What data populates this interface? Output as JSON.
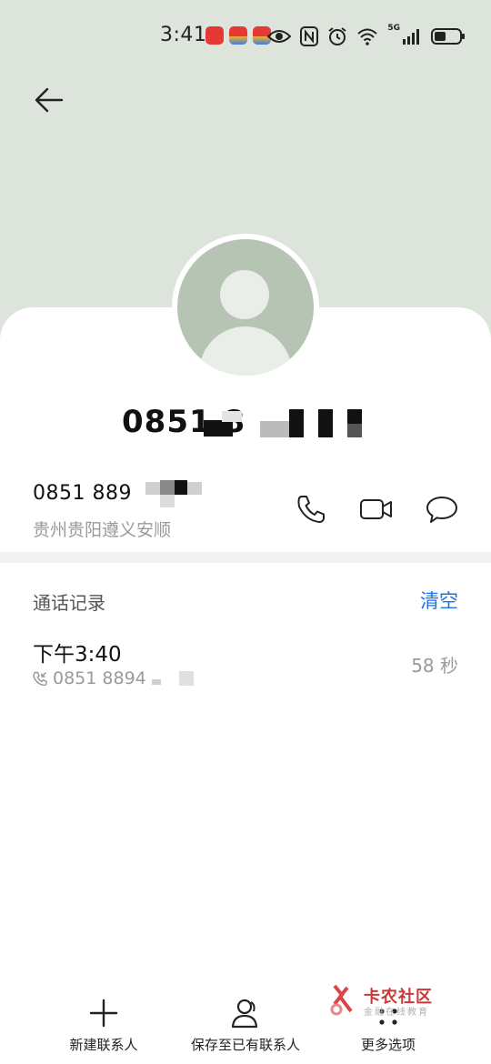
{
  "status_bar": {
    "time": "3:41",
    "network": "5G",
    "icons": [
      "notification-app-icon",
      "eye-icon",
      "nfc-icon",
      "alarm-icon",
      "wifi-icon",
      "signal-icon",
      "battery-icon"
    ]
  },
  "header": {
    "back_icon": "arrow-left-icon"
  },
  "contact": {
    "title_number": "0851 8",
    "phone_number": "0851 889",
    "location": "贵州贵阳遵义安顺",
    "actions": [
      "phone-icon",
      "video-call-icon",
      "message-icon"
    ]
  },
  "call_log": {
    "title": "通话记录",
    "clear_label": "清空",
    "entries": [
      {
        "time": "下午3:40",
        "number": "0851 8894",
        "duration": "58 秒"
      }
    ]
  },
  "bottom_bar": {
    "new_contact": "新建联系人",
    "save_existing": "保存至已有联系人",
    "more_options": "更多选项"
  },
  "watermark": {
    "title": "卡农社区",
    "subtitle": "金融在线教育"
  },
  "colors": {
    "header_bg": "#dde4dc",
    "avatar_bg": "#b6c4b4",
    "accent": "#1a73e8"
  }
}
